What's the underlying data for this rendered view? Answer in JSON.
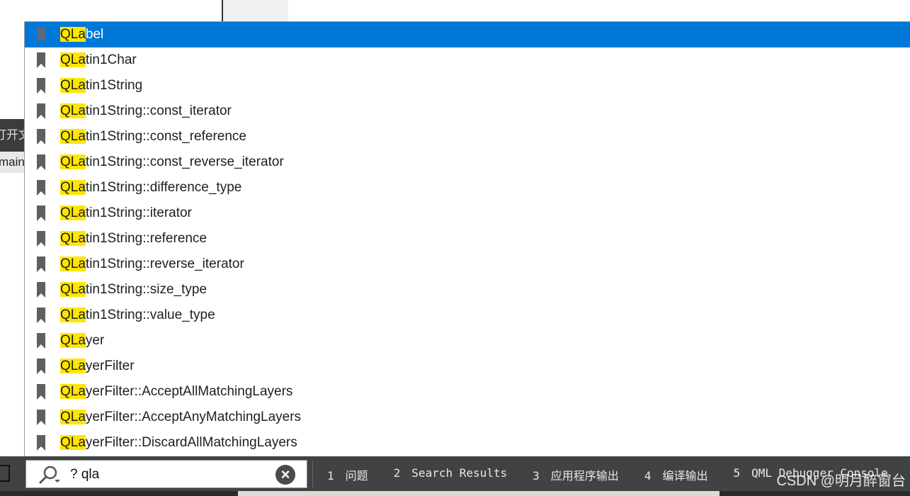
{
  "background": {
    "left_dark_text": "打开文",
    "left_light_text": "main.c"
  },
  "completion_popup": {
    "query_highlight_color": "#ffe600",
    "selected_color": "#0078d7",
    "items": [
      {
        "match": "QLa",
        "rest": "bel"
      },
      {
        "match": "QLa",
        "rest": "tin1Char"
      },
      {
        "match": "QLa",
        "rest": "tin1String"
      },
      {
        "match": "QLa",
        "rest": "tin1String::const_iterator"
      },
      {
        "match": "QLa",
        "rest": "tin1String::const_reference"
      },
      {
        "match": "QLa",
        "rest": "tin1String::const_reverse_iterator"
      },
      {
        "match": "QLa",
        "rest": "tin1String::difference_type"
      },
      {
        "match": "QLa",
        "rest": "tin1String::iterator"
      },
      {
        "match": "QLa",
        "rest": "tin1String::reference"
      },
      {
        "match": "QLa",
        "rest": "tin1String::reverse_iterator"
      },
      {
        "match": "QLa",
        "rest": "tin1String::size_type"
      },
      {
        "match": "QLa",
        "rest": "tin1String::value_type"
      },
      {
        "match": "QLa",
        "rest": "yer"
      },
      {
        "match": "QLa",
        "rest": "yerFilter"
      },
      {
        "match": "QLa",
        "rest": "yerFilter::AcceptAllMatchingLayers"
      },
      {
        "match": "QLa",
        "rest": "yerFilter::AcceptAnyMatchingLayers"
      },
      {
        "match": "QLa",
        "rest": "yerFilter::DiscardAllMatchingLayers"
      }
    ]
  },
  "locator": {
    "icon": "search-icon",
    "value": "? qla",
    "clear_icon": "clear-icon"
  },
  "output_panes": [
    {
      "num": "1",
      "label": "问题"
    },
    {
      "num": "2",
      "label": "Search Results"
    },
    {
      "num": "3",
      "label": "应用程序输出"
    },
    {
      "num": "4",
      "label": "编译输出"
    },
    {
      "num": "5",
      "label": "QML Debugger Console"
    }
  ],
  "watermark": "CSDN @明月醉窗台"
}
